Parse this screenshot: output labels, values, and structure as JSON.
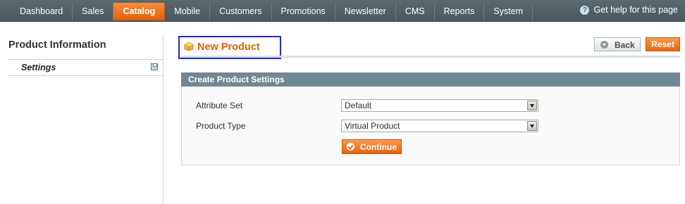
{
  "nav": {
    "items": [
      "Dashboard",
      "Sales",
      "Catalog",
      "Mobile",
      "Customers",
      "Promotions",
      "Newsletter",
      "CMS",
      "Reports",
      "System"
    ],
    "active": "Catalog",
    "help_label": "Get help for this page"
  },
  "sidebar": {
    "title": "Product Information",
    "tabs": [
      {
        "label": "Settings"
      }
    ]
  },
  "header": {
    "title": "New Product",
    "back_label": "Back",
    "reset_label": "Reset"
  },
  "settings": {
    "panel_title": "Create Product Settings",
    "attribute_set": {
      "label": "Attribute Set",
      "value": "Default"
    },
    "product_type": {
      "label": "Product Type",
      "value": "Virtual Product"
    },
    "continue_label": "Continue"
  },
  "colors": {
    "accent": "#eb5e00",
    "nav_bg": "#4f5c62",
    "panel_header": "#6f8992",
    "highlight_box": "#1d2bd6"
  }
}
